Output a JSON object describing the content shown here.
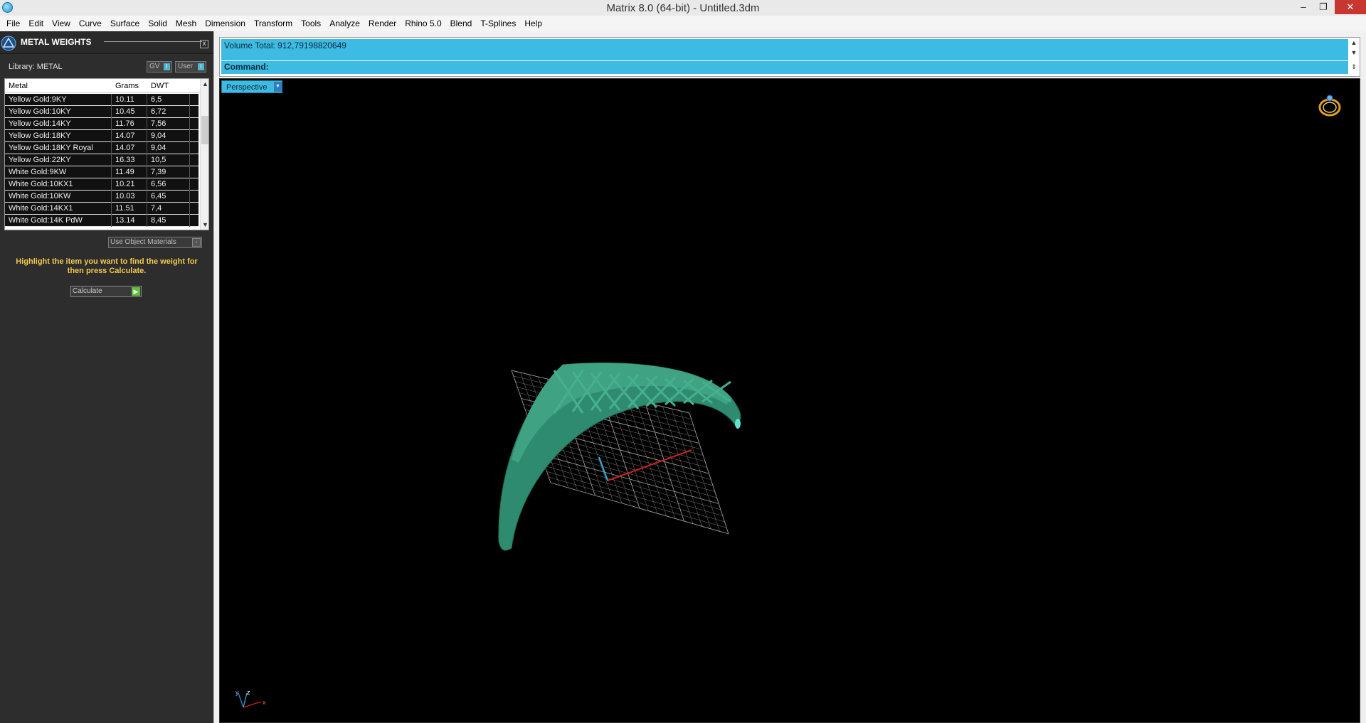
{
  "window": {
    "title": "Matrix 8.0 (64-bit) - Untitled.3dm",
    "minimize_glyph": "–",
    "maximize_glyph": "❐",
    "close_glyph": "✕"
  },
  "menu": [
    "File",
    "Edit",
    "View",
    "Curve",
    "Surface",
    "Solid",
    "Mesh",
    "Dimension",
    "Transform",
    "Tools",
    "Analyze",
    "Render",
    "Rhino 5.0",
    "Blend",
    "T-Splines",
    "Help"
  ],
  "panel": {
    "title": "METAL WEIGHTS",
    "close_glyph": "x",
    "library_label": "Library: METAL",
    "gv_label": "GV",
    "user_label": "User",
    "columns": [
      "Metal",
      "Grams",
      "DWT"
    ],
    "rows": [
      [
        "Yellow Gold:9KY",
        "10.11",
        "6,5"
      ],
      [
        "Yellow Gold:10KY",
        "10.45",
        "6,72"
      ],
      [
        "Yellow Gold:14KY",
        "11.76",
        "7,56"
      ],
      [
        "Yellow Gold:18KY",
        "14.07",
        "9,04"
      ],
      [
        "Yellow Gold:18KY Royal",
        "14.07",
        "9,04"
      ],
      [
        "Yellow Gold:22KY",
        "16.33",
        "10,5"
      ],
      [
        "White Gold:9KW",
        "11.49",
        "7,39"
      ],
      [
        "White Gold:10KX1",
        "10.21",
        "6,56"
      ],
      [
        "White Gold:10KW",
        "10.03",
        "6,45"
      ],
      [
        "White Gold:14KX1",
        "11.51",
        "7,4"
      ],
      [
        "White Gold:14K PdW",
        "13.14",
        "8,45"
      ]
    ],
    "use_object_materials": "Use Object Materials",
    "hint": "Highlight the item you want to find the weight for then press Calculate.",
    "calculate_label": "Calculate"
  },
  "command_area": {
    "history": "Volume Total: 912,79198820649",
    "command_prompt": "Command:"
  },
  "viewport": {
    "label": "Perspective",
    "model_color": "#2e8b6f",
    "grid_color": "#9a9a9a",
    "axis_labels": [
      "y",
      "z",
      "x"
    ]
  },
  "colors": {
    "accent": "#3dbbe3",
    "panel_bg": "#2d2d2d",
    "hint": "#f2c94c",
    "close_red": "#c7372f"
  }
}
